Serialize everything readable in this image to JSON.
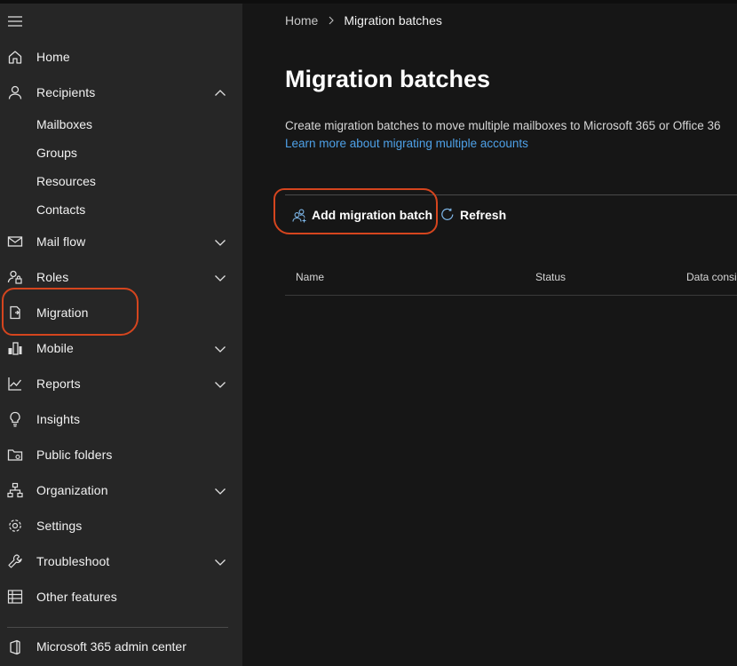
{
  "sidebar": {
    "items": [
      {
        "id": "home",
        "label": "Home",
        "icon": "home-icon"
      },
      {
        "id": "recipients",
        "label": "Recipients",
        "icon": "person-icon",
        "expanded": true,
        "children": [
          {
            "label": "Mailboxes"
          },
          {
            "label": "Groups"
          },
          {
            "label": "Resources"
          },
          {
            "label": "Contacts"
          }
        ]
      },
      {
        "id": "mail-flow",
        "label": "Mail flow",
        "icon": "mail-icon"
      },
      {
        "id": "roles",
        "label": "Roles",
        "icon": "person-lock-icon"
      },
      {
        "id": "migration",
        "label": "Migration",
        "icon": "migration-icon",
        "selected": true
      },
      {
        "id": "mobile",
        "label": "Mobile",
        "icon": "mobile-icon"
      },
      {
        "id": "reports",
        "label": "Reports",
        "icon": "chart-icon"
      },
      {
        "id": "insights",
        "label": "Insights",
        "icon": "lightbulb-icon"
      },
      {
        "id": "public-folders",
        "label": "Public folders",
        "icon": "folder-icon"
      },
      {
        "id": "organization",
        "label": "Organization",
        "icon": "org-icon"
      },
      {
        "id": "settings",
        "label": "Settings",
        "icon": "gear-icon"
      },
      {
        "id": "troubleshoot",
        "label": "Troubleshoot",
        "icon": "wrench-icon"
      },
      {
        "id": "other-features",
        "label": "Other features",
        "icon": "grid-icon"
      }
    ],
    "admin_center": {
      "label": "Microsoft 365 admin center",
      "icon": "office-icon"
    }
  },
  "breadcrumb": {
    "home": "Home",
    "current": "Migration batches"
  },
  "page": {
    "title": "Migration batches",
    "description": "Create migration batches to move multiple mailboxes to Microsoft 365 or Office 36",
    "learn_more": "Learn more about migrating multiple accounts"
  },
  "commands": {
    "add": "Add migration batch",
    "refresh": "Refresh"
  },
  "table": {
    "columns": [
      "Name",
      "Status",
      "Data consis"
    ]
  },
  "colors": {
    "accent": "#4ea1e8",
    "annotation": "#d5451e",
    "sidebar": "#262626",
    "background": "#161616"
  }
}
